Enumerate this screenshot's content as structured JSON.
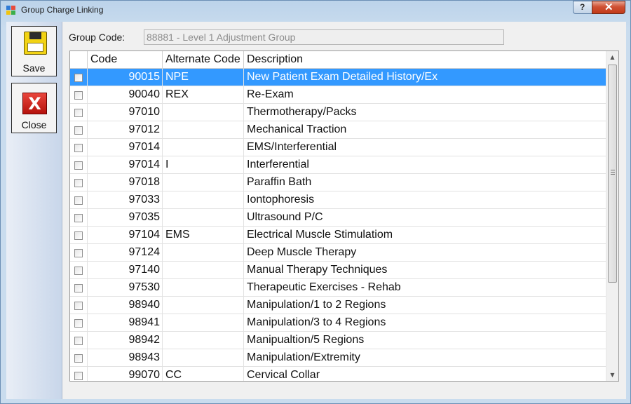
{
  "window": {
    "title": "Group Charge Linking",
    "help_label": "?",
    "close_label": "✕"
  },
  "toolbar": {
    "save_label": "Save",
    "close_label": "Close"
  },
  "group_code": {
    "label": "Group Code:",
    "value": "88881 - Level 1 Adjustment Group"
  },
  "grid": {
    "columns": [
      "Code",
      "Alternate Code",
      "Description"
    ],
    "rows": [
      {
        "code": "90015",
        "alt": "NPE",
        "desc": "New Patient Exam Detailed History/Ex",
        "selected": true
      },
      {
        "code": "90040",
        "alt": "REX",
        "desc": "Re-Exam"
      },
      {
        "code": "97010",
        "alt": "",
        "desc": "Thermotherapy/Packs"
      },
      {
        "code": "97012",
        "alt": "",
        "desc": "Mechanical Traction"
      },
      {
        "code": "97014",
        "alt": "",
        "desc": "EMS/Interferential"
      },
      {
        "code": "97014",
        "alt": "I",
        "desc": "Interferential"
      },
      {
        "code": "97018",
        "alt": "",
        "desc": "Paraffin Bath"
      },
      {
        "code": "97033",
        "alt": "",
        "desc": "Iontophoresis"
      },
      {
        "code": "97035",
        "alt": "",
        "desc": "Ultrasound P/C"
      },
      {
        "code": "97104",
        "alt": "EMS",
        "desc": "Electrical Muscle Stimulatiom"
      },
      {
        "code": "97124",
        "alt": "",
        "desc": "Deep Muscle Therapy"
      },
      {
        "code": "97140",
        "alt": "",
        "desc": "Manual Therapy Techniques"
      },
      {
        "code": "97530",
        "alt": "",
        "desc": "Therapeutic Exercises - Rehab"
      },
      {
        "code": "98940",
        "alt": "",
        "desc": "Manipulation/1 to 2 Regions"
      },
      {
        "code": "98941",
        "alt": "",
        "desc": "Manipulation/3 to 4 Regions"
      },
      {
        "code": "98942",
        "alt": "",
        "desc": "Manipualtion/5 Regions"
      },
      {
        "code": "98943",
        "alt": "",
        "desc": "Manipulation/Extremity"
      },
      {
        "code": "99070",
        "alt": "CC",
        "desc": "Cervical Collar"
      }
    ]
  },
  "scrollbar": {
    "up_arrow": "▲",
    "down_arrow": "▼"
  },
  "colors": {
    "selection": "#3399ff",
    "title_close": "#c23a18"
  }
}
